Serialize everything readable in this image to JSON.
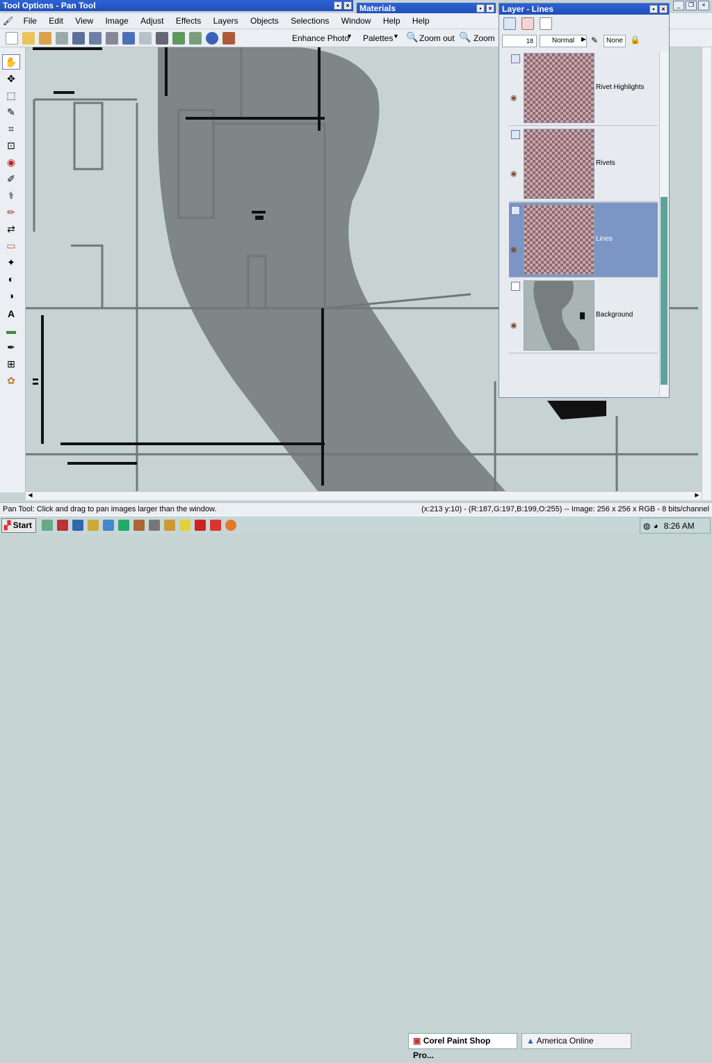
{
  "tool_options_title": "Tool Options - Pan Tool",
  "materials_title": "Materials",
  "layers_title": "Layer - Lines",
  "menu": [
    "File",
    "Edit",
    "View",
    "Image",
    "Adjust",
    "Effects",
    "Layers",
    "Objects",
    "Selections",
    "Window",
    "Help",
    "Help"
  ],
  "toolbar": {
    "enhance": "Enhance Photo",
    "palettes": "Palettes",
    "zoom_out": "Zoom out",
    "zoom": "Zoom"
  },
  "layer_opts": {
    "opacity": "18",
    "blend": "Normal",
    "mask": "None"
  },
  "layers": [
    {
      "name": "Rivet Highlights"
    },
    {
      "name": "Rivets"
    },
    {
      "name": "Lines"
    },
    {
      "name": "Background"
    }
  ],
  "status": {
    "left": "Pan Tool: Click and drag to pan images larger than the window.",
    "right": "(x:213 y:10) - (R:187,G:197,B:199,O:255) -- Image:  256 x 256 x RGB - 8 bits/channel"
  },
  "taskbar": {
    "start": "Start",
    "app1": "Corel Paint Shop Pro...",
    "app2": "America  Online",
    "clock": "8:26 AM"
  },
  "colors": {
    "accent": "#2d62d6",
    "selection": "#7b96c4"
  }
}
